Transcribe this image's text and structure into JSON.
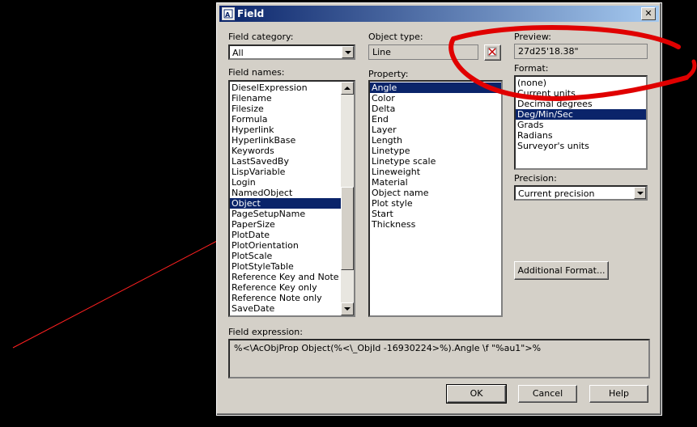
{
  "dialog": {
    "title": "Field",
    "close_glyph": "✕"
  },
  "field_category": {
    "label": "Field category:",
    "value": "All"
  },
  "field_names": {
    "label": "Field names:",
    "items": [
      "DieselExpression",
      "Filename",
      "Filesize",
      "Formula",
      "Hyperlink",
      "HyperlinkBase",
      "Keywords",
      "LastSavedBy",
      "LispVariable",
      "Login",
      "NamedObject",
      "Object",
      "PageSetupName",
      "PaperSize",
      "PlotDate",
      "PlotOrientation",
      "PlotScale",
      "PlotStyleTable",
      "Reference Key and Note",
      "Reference Key only",
      "Reference Note only",
      "SaveDate"
    ],
    "selected": "Object"
  },
  "object_type": {
    "label": "Object type:",
    "value": "Line",
    "pick_icon": "select-object-icon"
  },
  "property": {
    "label": "Property:",
    "items": [
      "Angle",
      "Color",
      "Delta",
      "End",
      "Layer",
      "Length",
      "Linetype",
      "Linetype scale",
      "Lineweight",
      "Material",
      "Object name",
      "Plot style",
      "Start",
      "Thickness"
    ],
    "selected": "Angle"
  },
  "preview": {
    "label": "Preview:",
    "value": "27d25'18.38\""
  },
  "format": {
    "label": "Format:",
    "items": [
      "(none)",
      "Current units",
      "Decimal degrees",
      "Deg/Min/Sec",
      "Grads",
      "Radians",
      "Surveyor's units"
    ],
    "selected": "Deg/Min/Sec"
  },
  "precision": {
    "label": "Precision:",
    "value": "Current precision"
  },
  "buttons": {
    "additional_format": "Additional Format...",
    "ok": "OK",
    "cancel": "Cancel",
    "help": "Help"
  },
  "field_expression": {
    "label": "Field expression:",
    "value": "%<\\AcObjProp Object(%<\\_ObjId -16930224>%).Angle \\f \"%au1\">%"
  },
  "colors": {
    "selection": "#0a246a",
    "annotation": "#ff0000",
    "background_line": "#ff0000"
  }
}
